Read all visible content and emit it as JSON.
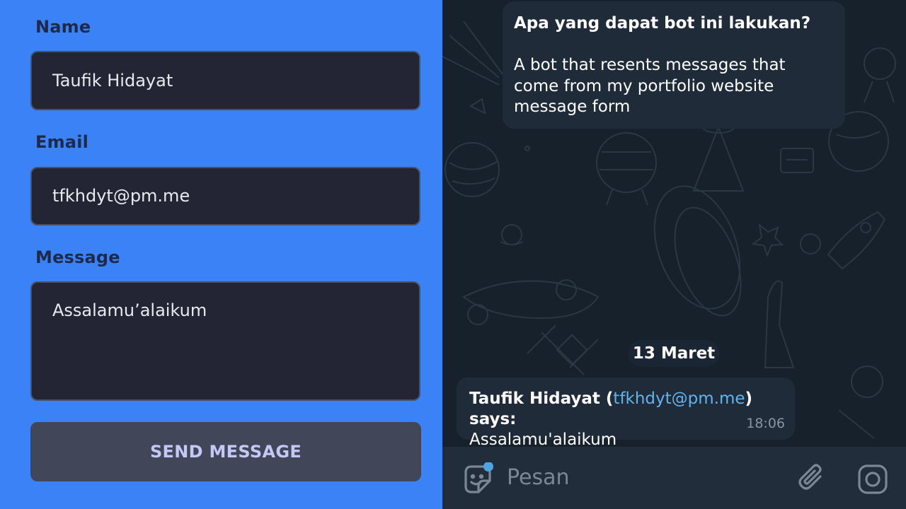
{
  "form": {
    "name_label": "Name",
    "name_value": "Taufik Hidayat",
    "email_label": "Email",
    "email_value": "tfkhdyt@pm.me",
    "message_label": "Message",
    "message_value": "Assalamu’alaikum",
    "send_label": "SEND MESSAGE",
    "colors": {
      "background": "#3b82f6",
      "field": "#232534",
      "button": "#414659",
      "button_text": "#c3c8f5"
    }
  },
  "chat": {
    "bot_info": {
      "title": "Apa yang dapat bot ini lakukan?",
      "description": "A bot that resents messages that come from my portfolio website message form"
    },
    "date_separator": "13 Maret",
    "message": {
      "sender": "Taufik Hidayat",
      "open_paren": " (",
      "email": "tfkhdyt@pm.me",
      "suffix": ") says:",
      "text": "Assalamu'alaikum",
      "time": "18:06"
    },
    "composer": {
      "placeholder": "Pesan",
      "icons": [
        "sticker-icon",
        "attach-icon",
        "camera-icon"
      ]
    },
    "colors": {
      "background": "#17212b",
      "bubble": "#1f2b38",
      "link": "#62b3ee"
    }
  }
}
